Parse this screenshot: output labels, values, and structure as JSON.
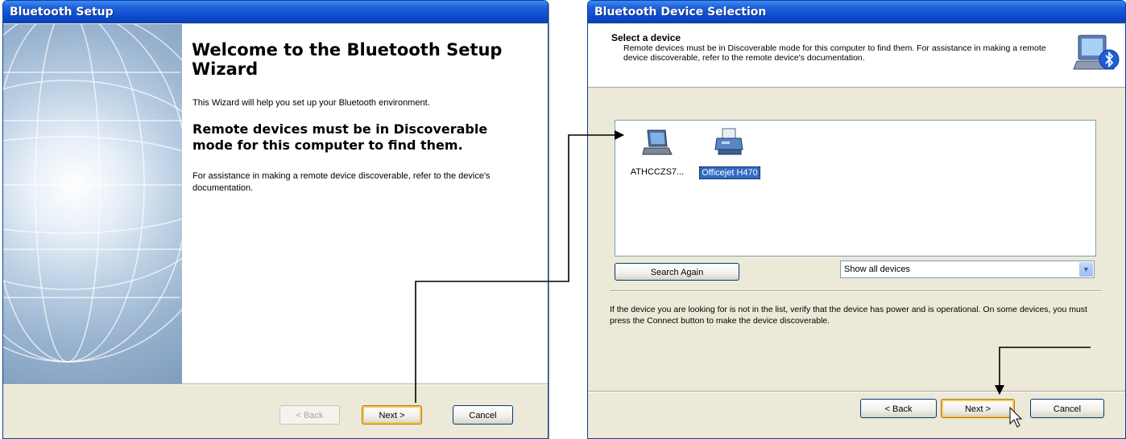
{
  "setup_window": {
    "title": "Bluetooth Setup",
    "heading": "Welcome to the Bluetooth Setup Wizard",
    "intro": "This Wizard will help you set up your Bluetooth environment.",
    "bold_note": "Remote devices must be in Discoverable mode for this computer to find them.",
    "help": "For assistance in making a remote device discoverable, refer to the device's documentation.",
    "buttons": {
      "back": "< Back",
      "next": "Next >",
      "cancel": "Cancel"
    }
  },
  "selection_window": {
    "title": "Bluetooth Device Selection",
    "header_title": "Select a device",
    "header_sub": "Remote devices must be in Discoverable mode for this computer to find them. For assistance in making a remote device discoverable, refer to the remote device's documentation.",
    "devices": [
      {
        "label": "ATHCCZS7...",
        "icon": "laptop-icon",
        "selected": false
      },
      {
        "label": "Officejet H470",
        "icon": "printer-icon",
        "selected": true
      }
    ],
    "search_again": "Search Again",
    "filter_value": "Show all devices",
    "help": "If the device you are looking for is not in the list, verify that the device has power and is operational. On some devices, you must press the Connect button to make the device discoverable.",
    "buttons": {
      "back": "< Back",
      "next": "Next >",
      "cancel": "Cancel"
    }
  },
  "colors": {
    "title_blue": "#0b4bd0",
    "selection": "#316ac5",
    "dialog_bg": "#ece9d8"
  }
}
